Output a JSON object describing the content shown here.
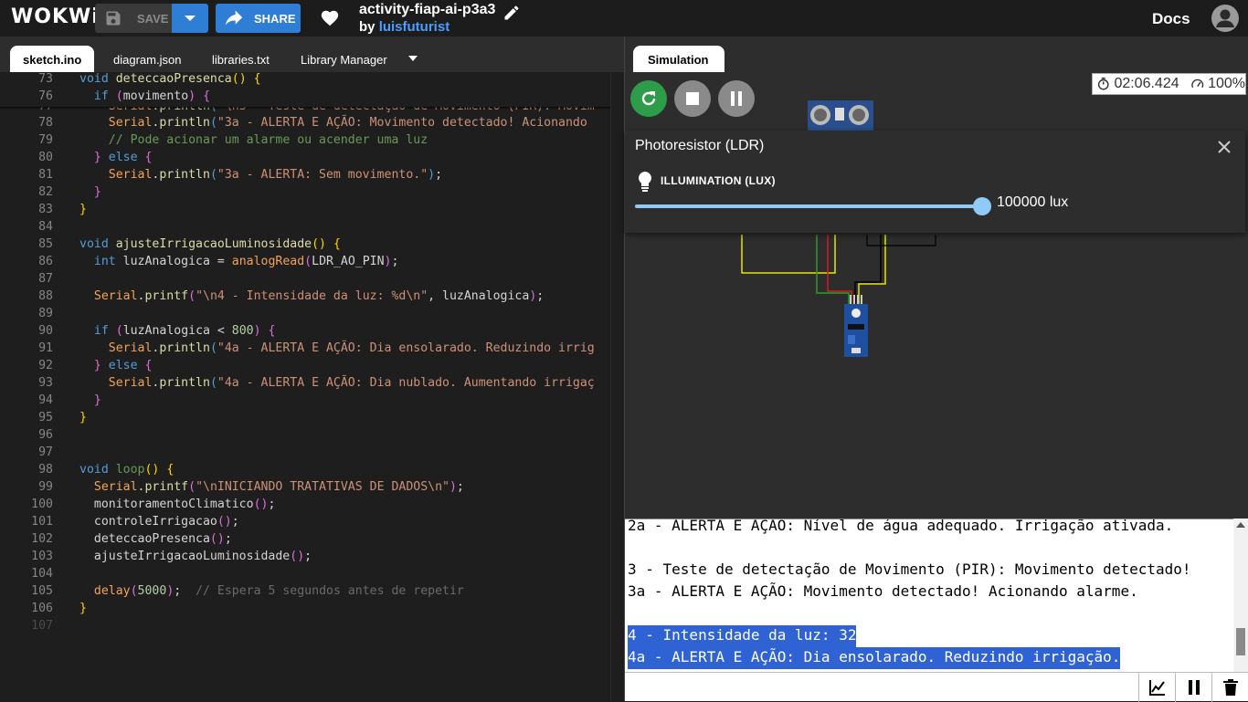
{
  "topbar": {
    "logo": "WOKWi",
    "save_label": "SAVE",
    "share_label": "SHARE",
    "project_title": "activity-fiap-ai-p3a3",
    "by_prefix": "by ",
    "author": "luisfuturist",
    "docs_label": "Docs"
  },
  "editor_tabs": [
    "sketch.ino",
    "diagram.json",
    "libraries.txt",
    "Library Manager"
  ],
  "simulation": {
    "tab_label": "Simulation",
    "timer": "02:06.424",
    "speed": "100%"
  },
  "ldr_panel": {
    "title": "Photoresistor (LDR)",
    "label": "ILLUMINATION (LUX)",
    "value_text": "100000 lux",
    "slider_fraction": 1.0
  },
  "serial_lines": [
    "2a - ALERTA E AÇÃO: Nível de água adequado. Irrigação ativada.",
    "",
    "3 - Teste de detectação de Movimento (PIR): Movimento detectado!",
    "3a - ALERTA E AÇÃO: Movimento detectado! Acionando alarme.",
    "",
    "4 - Intensidade da luz: 32",
    "4a - ALERTA E AÇÃO: Dia ensolarado. Reduzindo irrigação."
  ]
}
